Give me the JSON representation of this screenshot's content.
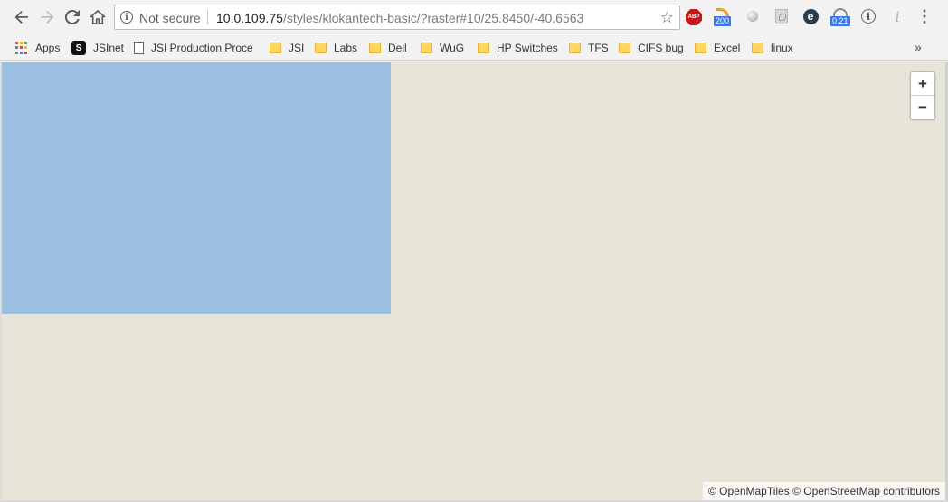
{
  "browser": {
    "address_bar": {
      "security_label": "Not secure",
      "url_host": "10.0.109.75",
      "url_path": "/styles/klokantech-basic/?raster#10/25.8450/-40.6563"
    },
    "extensions": {
      "abp_label": "ABP",
      "rss_badge": "200",
      "speed_badge": "0.21",
      "e_label": "e",
      "info_label": "i",
      "italic_label": "i"
    },
    "menu_glyph": "⋮"
  },
  "bookmarks": {
    "items": [
      {
        "label": "Apps",
        "icon": "apps-grid-icon"
      },
      {
        "label": "JSInet",
        "icon": "jsinet-icon"
      },
      {
        "label": "JSI Production Proce",
        "icon": "page-icon"
      },
      {
        "label": "JSI",
        "icon": "folder-icon"
      },
      {
        "label": "Labs",
        "icon": "folder-icon"
      },
      {
        "label": "Dell",
        "icon": "folder-icon"
      },
      {
        "label": "WuG",
        "icon": "folder-icon"
      },
      {
        "label": "HP Switches",
        "icon": "folder-icon"
      },
      {
        "label": "TFS",
        "icon": "folder-icon"
      },
      {
        "label": "CIFS bug",
        "icon": "folder-icon"
      },
      {
        "label": "Excel",
        "icon": "folder-icon"
      },
      {
        "label": "linux",
        "icon": "folder-icon"
      }
    ],
    "overflow_glyph": "»"
  },
  "map": {
    "zoom_in_label": "+",
    "zoom_out_label": "−",
    "attribution": "© OpenMapTiles © OpenStreetMap contributors",
    "colors": {
      "land": "#e8e4d8",
      "water": "#9bc0e2"
    }
  }
}
